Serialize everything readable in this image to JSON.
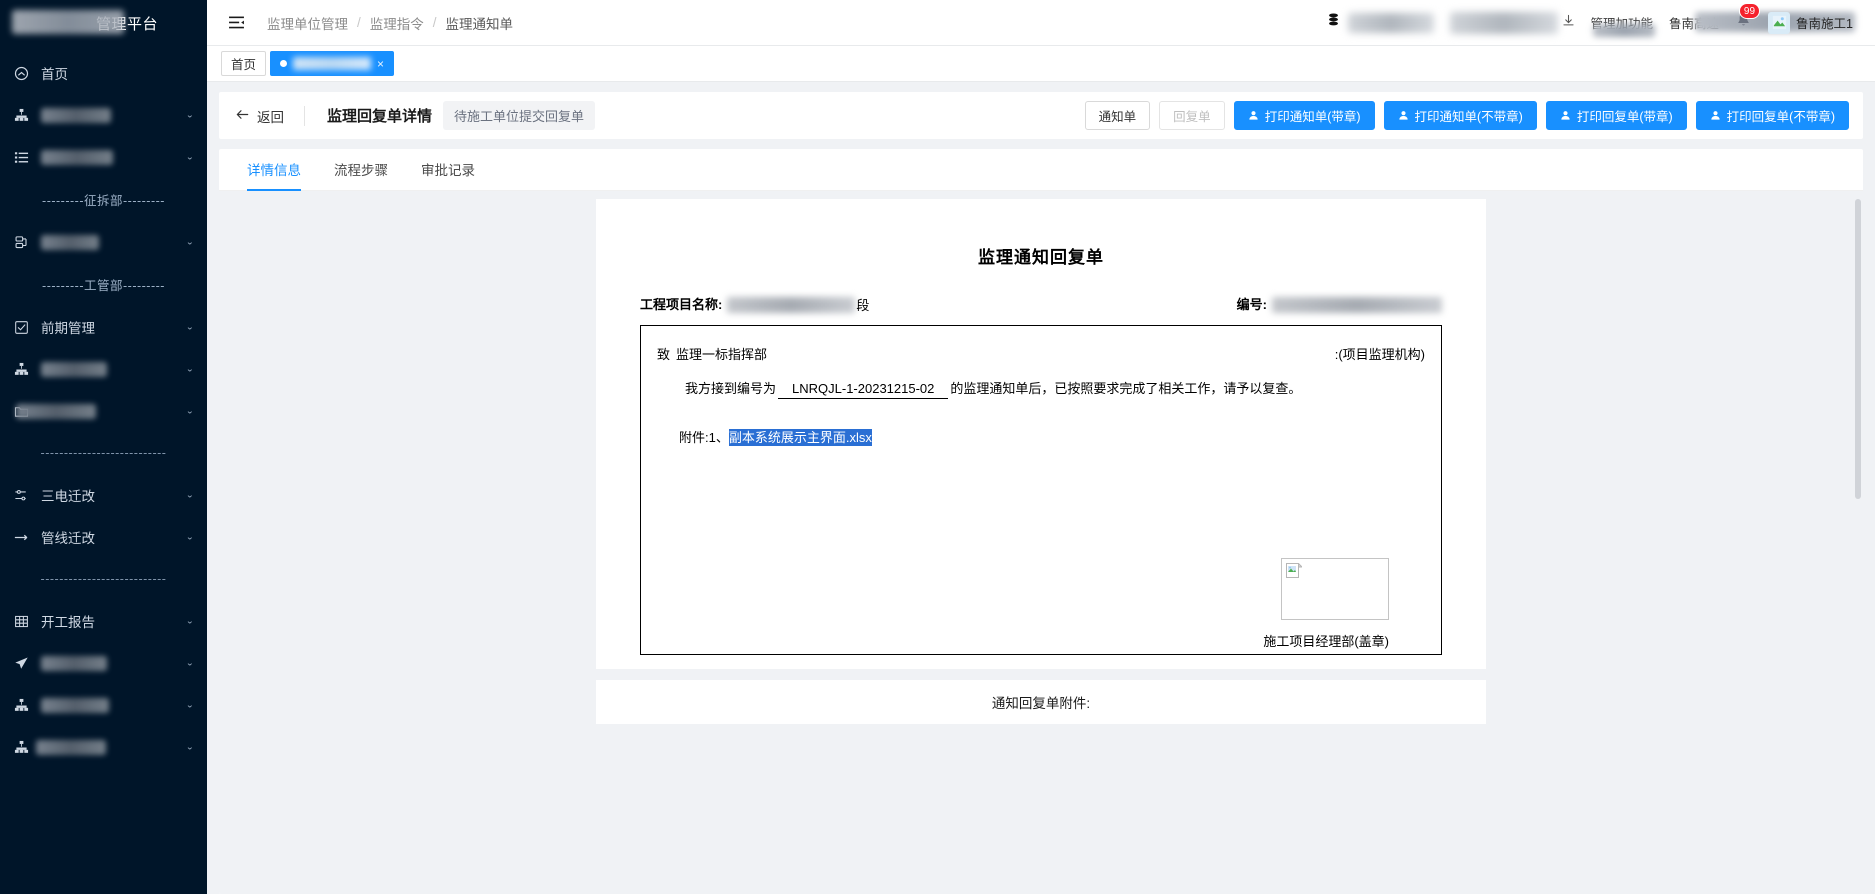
{
  "sidebar": {
    "logo_title": "管理平台",
    "items": [
      {
        "label": "首页",
        "icon": "dashboard-icon",
        "redacted": false,
        "has_chevron": false
      },
      {
        "label": "",
        "icon": "sitemap-icon",
        "redacted": true,
        "blur_width": 70,
        "has_chevron": true
      },
      {
        "label": "",
        "icon": "list-icon",
        "redacted": true,
        "blur_width": 72,
        "has_chevron": true
      },
      {
        "label": "---------征拆部---------",
        "type": "section"
      },
      {
        "label": "",
        "icon": "database-icon",
        "redacted": true,
        "blur_width": 58,
        "has_chevron": true
      },
      {
        "label": "---------工管部---------",
        "type": "section"
      },
      {
        "label": "前期管理",
        "icon": "check-square-icon",
        "redacted": false,
        "has_chevron": true
      },
      {
        "label": "",
        "icon": "sitemap-icon",
        "redacted": true,
        "blur_width": 66,
        "has_chevron": true
      },
      {
        "label": "",
        "icon": "folder-icon",
        "redacted": true,
        "blur_width": 80,
        "has_chevron": true
      },
      {
        "label": "---------------------------",
        "type": "dash"
      },
      {
        "label": "三电迁改",
        "icon": "sliders-icon",
        "redacted": false,
        "has_chevron": true
      },
      {
        "label": "管线迁改",
        "icon": "minus-line-icon",
        "redacted": false,
        "has_chevron": true
      },
      {
        "label": "---------------------------",
        "type": "dash"
      },
      {
        "label": "开工报告",
        "icon": "table-icon",
        "redacted": false,
        "has_chevron": true
      },
      {
        "label": "",
        "icon": "send-icon",
        "redacted": true,
        "blur_width": 66,
        "has_chevron": true
      },
      {
        "label": "",
        "icon": "sitemap-icon",
        "redacted": true,
        "blur_width": 68,
        "has_chevron": true
      },
      {
        "label": "",
        "icon": "sitemap-icon",
        "redacted": true,
        "blur_width": 70,
        "has_chevron": true
      }
    ]
  },
  "topbar": {
    "collapse_icon": "menu-fold-icon",
    "breadcrumb": [
      "监理单位管理",
      "监理指令",
      "监理通知单"
    ],
    "separator": "/",
    "notification_badge": "99",
    "user_name": "鲁南施工1",
    "right_items": [
      {
        "icon": "database-icon",
        "redacted": true,
        "blur_width": 86
      },
      {
        "icon": "download-icon",
        "redacted": true,
        "blur_width": 108
      },
      {
        "icon": "",
        "redacted": true,
        "blur_width": 62,
        "text": "管理加功能"
      },
      {
        "icon": "",
        "redacted": true,
        "blur_width": 150,
        "text": "鲁南高速"
      },
      {
        "icon": "bell-icon",
        "redacted": true,
        "blur_width": 14
      }
    ]
  },
  "page_tabs": [
    {
      "label": "首页",
      "active": false,
      "closable": false
    },
    {
      "label": "",
      "active": true,
      "closable": true,
      "redacted": true,
      "close_label": "×"
    }
  ],
  "title_bar": {
    "back_label": "返回",
    "back_icon": "arrow-left-icon",
    "title": "监理回复单详情",
    "status": "待施工单位提交回复单",
    "buttons": [
      {
        "label": "通知单",
        "type": "default",
        "icon": null
      },
      {
        "label": "回复单",
        "type": "disabled",
        "icon": null
      },
      {
        "label": "打印通知单(带章)",
        "type": "primary",
        "icon": "user-icon"
      },
      {
        "label": "打印通知单(不带章)",
        "type": "primary",
        "icon": "user-icon"
      },
      {
        "label": "打印回复单(带章)",
        "type": "primary",
        "icon": "user-icon"
      },
      {
        "label": "打印回复单(不带章)",
        "type": "primary",
        "icon": "user-icon"
      }
    ]
  },
  "inner_tabs": [
    {
      "label": "详情信息",
      "active": true
    },
    {
      "label": "流程步骤",
      "active": false
    },
    {
      "label": "审批记录",
      "active": false
    }
  ],
  "document": {
    "heading": "监理通知回复单",
    "project_label": "工程项目名称:",
    "project_value_redacted": true,
    "project_value_tail": "段",
    "number_label": "编号:",
    "number_value_redacted": true,
    "to_label": "致",
    "to_value": "监理一标指挥部",
    "to_right": ":(项目监理机构)",
    "para_prefix": "我方接到编号为",
    "notice_number": "LNRQJL-1-20231215-02",
    "para_suffix": "的监理通知单后，已按照要求完成了相关工作，请予以复查。",
    "attachment_prefix": "附件:1、",
    "attachment_name": "副本系统展示主界面.xlsx",
    "attachment_selected": true,
    "sign_label": "施工项目经理部(盖章)",
    "image_placeholder_icon": "broken-image-icon"
  },
  "footer_panel": {
    "title": "通知回复单附件:"
  },
  "colors": {
    "sidebar_bg": "#001529",
    "primary": "#1890ff",
    "badge_red": "#f5222d",
    "page_bg": "#f0f2f5",
    "selection_blue": "#2a6fd4"
  }
}
